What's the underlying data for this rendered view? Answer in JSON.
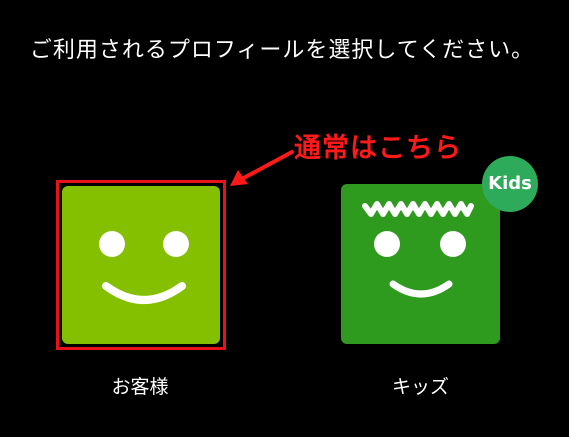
{
  "prompt": {
    "text": "ご利用されるプロフィールを選択してください。"
  },
  "annotation": {
    "text": "通常はこちら",
    "color": "#ff1a1a"
  },
  "profiles": [
    {
      "name": "お客様",
      "avatar_color": "#84c000",
      "icon": "smiley-face-icon",
      "highlighted": true
    },
    {
      "name": "キッズ",
      "avatar_color": "#2e9a1e",
      "icon": "kids-smiley-face-icon",
      "badge": "Kids",
      "badge_color": "#2daa5a"
    }
  ]
}
